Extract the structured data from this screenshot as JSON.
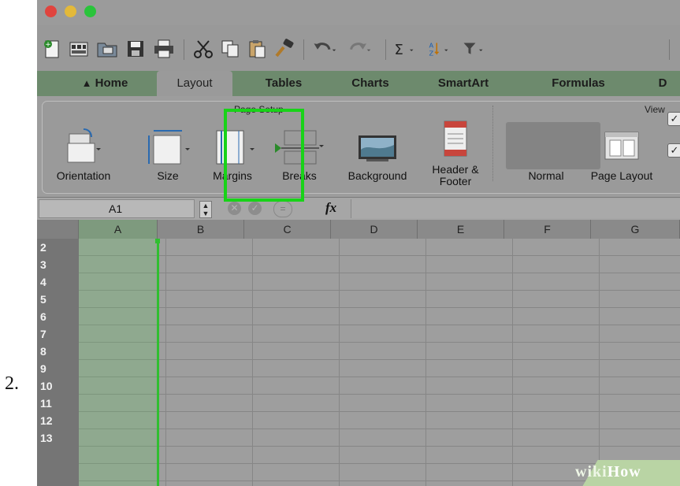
{
  "step": {
    "number": "2."
  },
  "window": {
    "traffic_colors": [
      "#e0443e",
      "#e3b93a",
      "#2ac43b"
    ]
  },
  "toolbar": {
    "icons": [
      "new-workbook-icon",
      "templates-icon",
      "open-icon",
      "save-icon",
      "print-icon",
      "cut-icon",
      "copy-icon",
      "paste-icon",
      "format-painter-icon",
      "undo-icon",
      "redo-icon",
      "autosum-icon",
      "sort-icon",
      "filter-icon"
    ]
  },
  "tabs": [
    {
      "label": "Home"
    },
    {
      "label": "Layout"
    },
    {
      "label": "Tables"
    },
    {
      "label": "Charts"
    },
    {
      "label": "SmartArt"
    },
    {
      "label": "Formulas"
    },
    {
      "label": "D"
    }
  ],
  "ribbon": {
    "group_page_setup": "Page Setup",
    "group_view": "View",
    "buttons": {
      "orientation": "Orientation",
      "size": "Size",
      "margins": "Margins",
      "breaks": "Breaks",
      "background": "Background",
      "header_footer_line1": "Header &",
      "header_footer_line2": "Footer",
      "normal": "Normal",
      "page_layout": "Page Layout"
    }
  },
  "formula_bar": {
    "name_box": "A1",
    "fx": "fx"
  },
  "grid": {
    "columns": [
      "A",
      "B",
      "C",
      "D",
      "E",
      "F",
      "G"
    ],
    "rows": [
      "2",
      "3",
      "4",
      "5",
      "6",
      "7",
      "8",
      "9",
      "10",
      "11",
      "12",
      "13"
    ]
  },
  "watermark": {
    "part1": "wiki",
    "part2": "How"
  },
  "colors": {
    "highlight": "#18d318",
    "tab_bar": "#6d8a6d",
    "selected_column": "#8fa98f"
  }
}
